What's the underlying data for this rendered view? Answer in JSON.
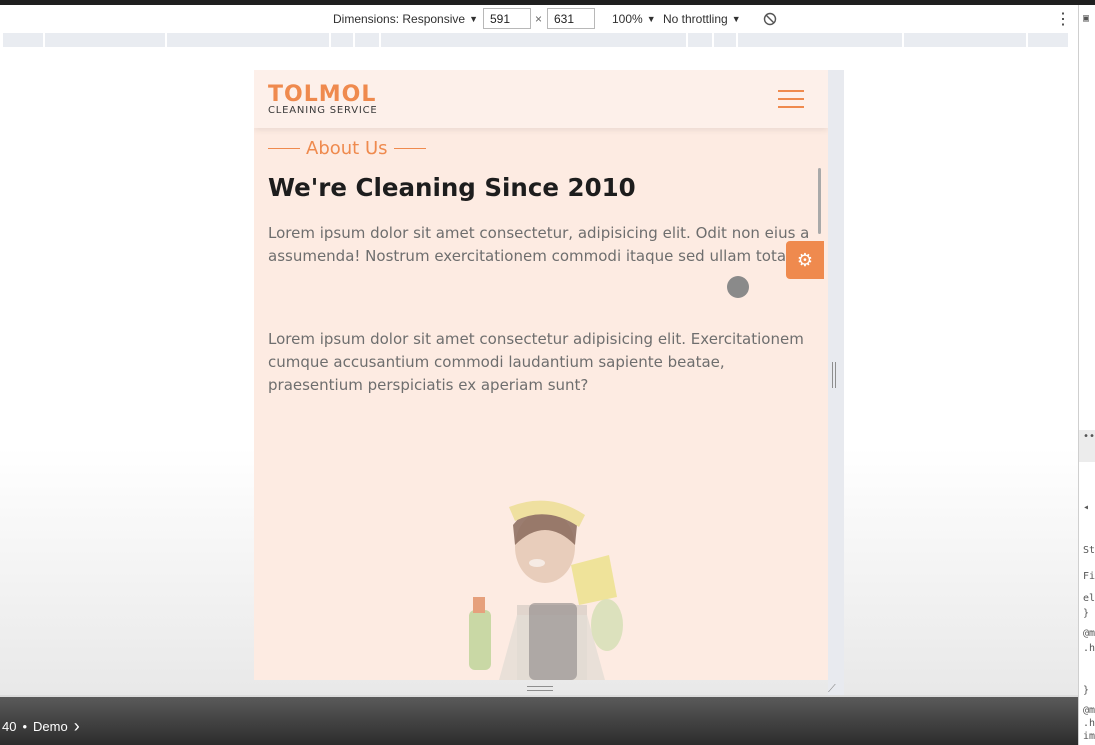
{
  "toolbar": {
    "dimensions_label": "Dimensions: Responsive",
    "width_value": "591",
    "height_value": "631",
    "times_sign": "×",
    "zoom_label": "100%",
    "throttle_label": "No throttling",
    "caret": "▼",
    "rotate_glyph": "⃠",
    "more_glyph": "⋮"
  },
  "site": {
    "logo": "TOLMOL",
    "logo_sub": "CLEANING SERVICE",
    "section_tag": "About Us",
    "heading": "We're Cleaning Since 2010",
    "paragraph1": "Lorem ipsum dolor sit amet consectetur, adipisicing elit. Odit non eius a assumenda! Nostrum exercitationem commodi itaque sed ullam totam!",
    "paragraph2": "Lorem ipsum dolor sit amet consectetur adipisicing elit. Exercitationem cumque accusantium commodi laudantium sapiente beatae, praesentium perspiciatis ex aperiam sunt?",
    "gear_glyph": "⚙"
  },
  "bottom_bar": {
    "number": "40",
    "separator": "•",
    "label": "Demo",
    "chevron": "›"
  },
  "devtools": {
    "dots": "•••",
    "st": "St",
    "fi": "Fi",
    "el": "el",
    "brace": "}",
    "at": "@m",
    "dot_h": ".h",
    "im": "im"
  },
  "colors": {
    "accent": "#ef8a4e",
    "page_bg": "#fdebe2",
    "heading": "#1d1d1d",
    "text": "#6e6e6e"
  }
}
